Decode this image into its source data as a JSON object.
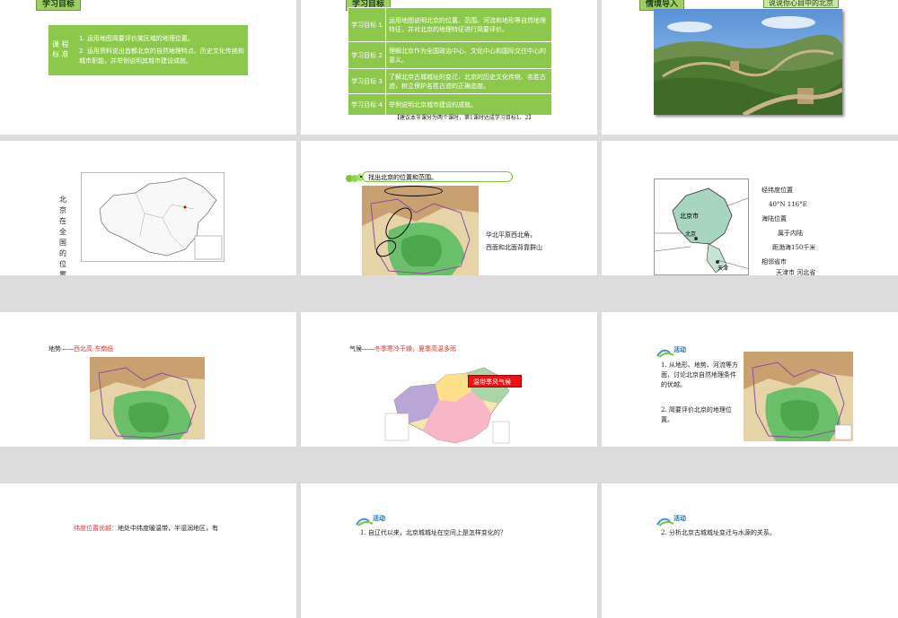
{
  "slides": {
    "s1": {
      "header": "学习目标",
      "label": "课 程 标 准",
      "items": [
        "1. 运用地图简要评价某区域的地理位置。",
        "2. 运用资料说出首都北京的自然地理特点、历史文化传统和城市职能，并举例说明其城市建设成就。"
      ]
    },
    "s2": {
      "header": "学习目标",
      "rows": [
        {
          "label": "学习目标 1",
          "text": "运用地图说明北京的位置、范围、河流和地形等自然地理特征，并对北京的地理特征进行简要评价。"
        },
        {
          "label": "学习目标 2",
          "text": "理解北京作为全国政治中心、文化中心和国际交往中心的意义。"
        },
        {
          "label": "学习目标 3",
          "text": "了解北京古城城址的变迁、北京的历史文化传统、名胜古迹，树立保护名胜古迹的正确态度。"
        },
        {
          "label": "学习目标 4",
          "text": "举例说明北京城市建设的成就。"
        }
      ],
      "note": "【建议本节课分为两个课时，第1课时达成学习目标1、2】"
    },
    "s3": {
      "header": "情境导入",
      "caption": "说说你心目中的北京"
    },
    "s4": {
      "vertical_label": "北京在全国的位置"
    },
    "s5": {
      "prompt": "找出北京的位置和范围。",
      "note1": "华北平原西北角，",
      "note2": "西面和北面背靠群山"
    },
    "s6": {
      "lines": [
        {
          "text": "经纬度位置",
          "color": "#222"
        },
        {
          "text": "40°N  116°E",
          "color": "#e8322a"
        },
        {
          "text": "海陆位置",
          "color": "#222"
        },
        {
          "text": "属于内陆",
          "color": "#e8322a"
        },
        {
          "text": "距渤海150千米",
          "color": "#e8322a"
        },
        {
          "text": "相邻省市",
          "color": "#222"
        },
        {
          "text": "天津市  河北省",
          "color": "#e8322a"
        }
      ],
      "map_labels": [
        "北京市",
        "北京",
        "天津"
      ]
    },
    "s7": {
      "prefix": "地势——",
      "value": "西北高  东南低"
    },
    "s8": {
      "prefix": "气候——",
      "value": "冬季寒冷干燥，夏季高温多雨",
      "callout": "温带季风气候"
    },
    "s9": {
      "activity": "活动",
      "q1": "1. 从地形、地势、河流等方面，讨论北京自然地理条件的优越。",
      "q2": "2. 简要评价北京的地理位置。"
    },
    "s10": {
      "label": "纬度位置优越：",
      "text": "地处中纬度暖温带，半湿润地区，有"
    },
    "s11": {
      "activity": "活动",
      "q1": "1. 自辽代以来，北京城城址在空间上是怎样变化的？"
    },
    "s12": {
      "activity": "活动",
      "q1": "2. 分析北京古城城址变迁与水源的关系。"
    }
  }
}
